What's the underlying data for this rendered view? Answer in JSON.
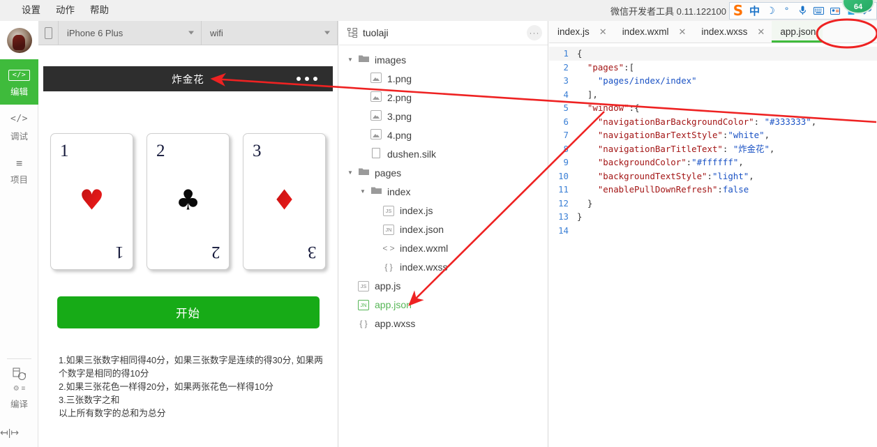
{
  "menubar": {
    "items": [
      {
        "label": "设置",
        "name": "menu-settings"
      },
      {
        "label": "动作",
        "name": "menu-actions"
      },
      {
        "label": "帮助",
        "name": "menu-help"
      }
    ],
    "app_title": "微信开发者工具 0.11.122100",
    "ime": {
      "logo": "S",
      "mode_label": "中",
      "moon_icon": "☽",
      "degree_icon": "°",
      "mic_icon": "🎤",
      "keyboard_icon": "⌨",
      "card_icon": "🪪",
      "shirt_icon": "👕",
      "wrench_icon": "🔧"
    },
    "badge": "64"
  },
  "rail": {
    "items": [
      {
        "label": "编辑",
        "glyph": "</>",
        "name": "rail-item-edit",
        "active": true
      },
      {
        "label": "调试",
        "glyph": "</>",
        "name": "rail-item-debug",
        "active": false
      },
      {
        "label": "项目",
        "glyph": "≡",
        "name": "rail-item-project",
        "active": false
      }
    ],
    "compile": {
      "label": "编译",
      "sub": "⚙ ≡"
    },
    "drag_handle": "↤|↦"
  },
  "simulator": {
    "device": "iPhone 6 Plus",
    "network": "wifi",
    "phone": {
      "nav_title": "炸金花",
      "cards": [
        {
          "number": "1",
          "suit": "♥",
          "color": "red"
        },
        {
          "number": "2",
          "suit": "♣",
          "color": "black"
        },
        {
          "number": "3",
          "suit": "♦",
          "color": "red"
        }
      ],
      "start_label": "开始",
      "rules": [
        "1.如果三张数字相同得40分，如果三张数字是连续的得30分, 如果两个数字是相同的得10分",
        "2.如果三张花色一样得20分，如果两张花色一样得10分",
        "3.三张数字之和",
        "以上所有数字的总和为总分"
      ]
    }
  },
  "filetree": {
    "project_name": "tuolaji",
    "more_label": "···",
    "nodes": [
      {
        "label": "images",
        "indent": 0,
        "kind": "folder",
        "open": true,
        "name": "tree-folder-images"
      },
      {
        "label": "1.png",
        "indent": 1,
        "kind": "image",
        "name": "tree-file-1-png"
      },
      {
        "label": "2.png",
        "indent": 1,
        "kind": "image",
        "name": "tree-file-2-png"
      },
      {
        "label": "3.png",
        "indent": 1,
        "kind": "image",
        "name": "tree-file-3-png"
      },
      {
        "label": "4.png",
        "indent": 1,
        "kind": "image",
        "name": "tree-file-4-png"
      },
      {
        "label": "dushen.silk",
        "indent": 1,
        "kind": "file",
        "name": "tree-file-dushen-silk"
      },
      {
        "label": "pages",
        "indent": 0,
        "kind": "folder",
        "open": true,
        "name": "tree-folder-pages"
      },
      {
        "label": "index",
        "indent": 1,
        "kind": "folder",
        "open": true,
        "name": "tree-folder-index"
      },
      {
        "label": "index.js",
        "indent": 2,
        "kind": "js",
        "name": "tree-file-index-js"
      },
      {
        "label": "index.json",
        "indent": 2,
        "kind": "jn",
        "name": "tree-file-index-json"
      },
      {
        "label": "index.wxml",
        "indent": 2,
        "kind": "wxml",
        "name": "tree-file-index-wxml"
      },
      {
        "label": "index.wxss",
        "indent": 2,
        "kind": "wxss",
        "name": "tree-file-index-wxss"
      },
      {
        "label": "app.js",
        "indent": 0,
        "kind": "js",
        "name": "tree-file-app-js"
      },
      {
        "label": "app.json",
        "indent": 0,
        "kind": "jn",
        "name": "tree-file-app-json",
        "selected": true
      },
      {
        "label": "app.wxss",
        "indent": 0,
        "kind": "wxss",
        "name": "tree-file-app-wxss"
      }
    ]
  },
  "editor": {
    "tabs": [
      {
        "label": "index.js",
        "closable": true,
        "active": false,
        "name": "tab-index-js"
      },
      {
        "label": "index.wxml",
        "closable": true,
        "active": false,
        "name": "tab-index-wxml"
      },
      {
        "label": "index.wxss",
        "closable": true,
        "active": false,
        "name": "tab-index-wxss"
      },
      {
        "label": "app.json",
        "closable": false,
        "active": true,
        "name": "tab-app-json"
      }
    ],
    "close_glyph": "✕",
    "lines": [
      {
        "n": "1",
        "tokens": [
          {
            "t": "{",
            "c": "p"
          }
        ]
      },
      {
        "n": "2",
        "tokens": [
          {
            "t": "  ",
            "c": "p"
          },
          {
            "t": "\"pages\"",
            "c": "k"
          },
          {
            "t": ":[",
            "c": "p"
          }
        ]
      },
      {
        "n": "3",
        "tokens": [
          {
            "t": "    ",
            "c": "p"
          },
          {
            "t": "\"pages/index/index\"",
            "c": "s"
          }
        ]
      },
      {
        "n": "4",
        "tokens": [
          {
            "t": "  ],",
            "c": "p"
          }
        ]
      },
      {
        "n": "5",
        "tokens": [
          {
            "t": "  ",
            "c": "p"
          },
          {
            "t": "\"window\"",
            "c": "k"
          },
          {
            "t": ":{",
            "c": "p"
          }
        ]
      },
      {
        "n": "6",
        "tokens": [
          {
            "t": "    ",
            "c": "p"
          },
          {
            "t": "\"navigationBarBackgroundColor\"",
            "c": "k"
          },
          {
            "t": ": ",
            "c": "p"
          },
          {
            "t": "\"#333333\"",
            "c": "s"
          },
          {
            "t": ",",
            "c": "p"
          }
        ]
      },
      {
        "n": "7",
        "tokens": [
          {
            "t": "    ",
            "c": "p"
          },
          {
            "t": "\"navigationBarTextStyle\"",
            "c": "k"
          },
          {
            "t": ":",
            "c": "p"
          },
          {
            "t": "\"white\"",
            "c": "s"
          },
          {
            "t": ",",
            "c": "p"
          }
        ]
      },
      {
        "n": "8",
        "tokens": [
          {
            "t": "    ",
            "c": "p"
          },
          {
            "t": "\"navigationBarTitleText\"",
            "c": "k"
          },
          {
            "t": ": ",
            "c": "p"
          },
          {
            "t": "\"炸金花\"",
            "c": "s"
          },
          {
            "t": ",",
            "c": "p"
          }
        ]
      },
      {
        "n": "9",
        "tokens": [
          {
            "t": "    ",
            "c": "p"
          },
          {
            "t": "\"backgroundColor\"",
            "c": "k"
          },
          {
            "t": ":",
            "c": "p"
          },
          {
            "t": "\"#ffffff\"",
            "c": "s"
          },
          {
            "t": ",",
            "c": "p"
          }
        ]
      },
      {
        "n": "10",
        "tokens": [
          {
            "t": "    ",
            "c": "p"
          },
          {
            "t": "\"backgroundTextStyle\"",
            "c": "k"
          },
          {
            "t": ":",
            "c": "p"
          },
          {
            "t": "\"light\"",
            "c": "s"
          },
          {
            "t": ",",
            "c": "p"
          }
        ]
      },
      {
        "n": "11",
        "tokens": [
          {
            "t": "    ",
            "c": "p"
          },
          {
            "t": "\"enablePullDownRefresh\"",
            "c": "k"
          },
          {
            "t": ":",
            "c": "p"
          },
          {
            "t": "false",
            "c": "b"
          }
        ]
      },
      {
        "n": "12",
        "tokens": [
          {
            "t": "  }",
            "c": "p"
          }
        ]
      },
      {
        "n": "13",
        "tokens": [
          {
            "t": "}",
            "c": "p"
          }
        ]
      },
      {
        "n": "14",
        "tokens": [
          {
            "t": "",
            "c": "p"
          }
        ]
      }
    ]
  },
  "annotations": {
    "color": "#ee2222",
    "arrow_to_nav_title": "arrow pointing from app.json code to simulator nav title",
    "arrow_to_app_json_file": "arrow pointing from code to app.json in file tree",
    "circle_on_tab": "red ellipse around app.json tab"
  },
  "colors": {
    "accent_green": "#3fbb3c",
    "nav_bar_bg": "#2e2e2e",
    "start_button": "#17ab17",
    "annotation_red": "#ee2222",
    "code_key": "#a31515",
    "code_string": "#1a52c4",
    "line_number": "#3a7fd5"
  }
}
